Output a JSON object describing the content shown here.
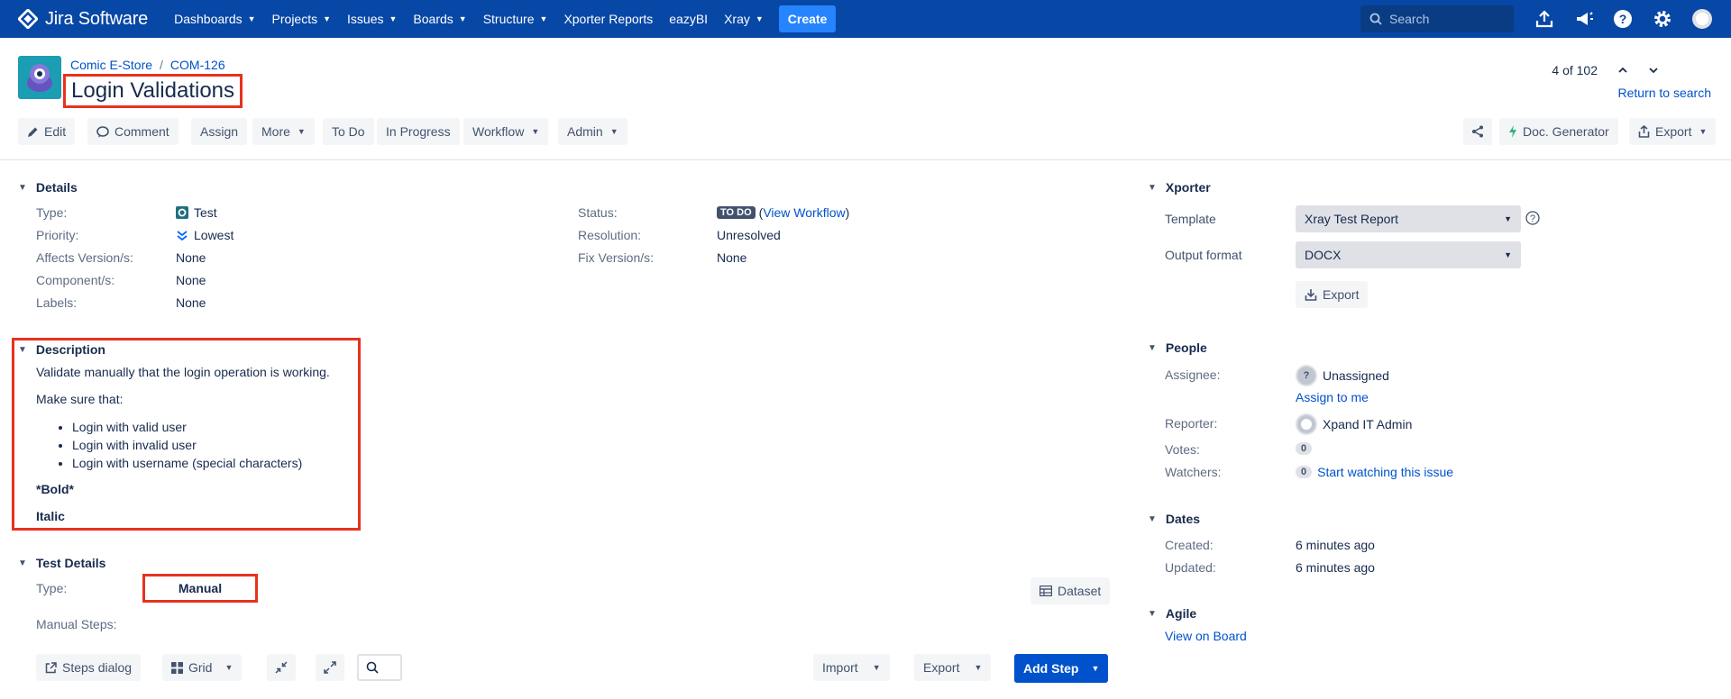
{
  "app": {
    "logo_text": "Jira Software",
    "nav": [
      {
        "label": "Dashboards",
        "dropdown": true
      },
      {
        "label": "Projects",
        "dropdown": true
      },
      {
        "label": "Issues",
        "dropdown": true
      },
      {
        "label": "Boards",
        "dropdown": true
      },
      {
        "label": "Structure",
        "dropdown": true
      },
      {
        "label": "Xporter Reports",
        "dropdown": false
      },
      {
        "label": "eazyBI",
        "dropdown": false
      },
      {
        "label": "Xray",
        "dropdown": true
      }
    ],
    "create_label": "Create",
    "search_placeholder": "Search"
  },
  "header": {
    "breadcrumb_project": "Comic E-Store",
    "breadcrumb_sep": "/",
    "breadcrumb_issue": "COM-126",
    "title": "Login Validations",
    "pager": "4 of 102",
    "return_link": "Return to search"
  },
  "toolbar": {
    "edit": "Edit",
    "comment": "Comment",
    "assign": "Assign",
    "more": "More",
    "todo": "To Do",
    "in_progress": "In Progress",
    "workflow": "Workflow",
    "admin": "Admin",
    "doc_generator": "Doc. Generator",
    "export": "Export"
  },
  "details": {
    "heading": "Details",
    "type_label": "Type:",
    "type_value": "Test",
    "priority_label": "Priority:",
    "priority_value": "Lowest",
    "affects_label": "Affects Version/s:",
    "affects_value": "None",
    "component_label": "Component/s:",
    "component_value": "None",
    "labels_label": "Labels:",
    "labels_value": "None",
    "status_label": "Status:",
    "status_value": "TO DO",
    "view_workflow": "View Workflow",
    "resolution_label": "Resolution:",
    "resolution_value": "Unresolved",
    "fix_label": "Fix Version/s:",
    "fix_value": "None"
  },
  "description": {
    "heading": "Description",
    "line1": "Validate manually that the login operation is working.",
    "line2": "Make sure that:",
    "items": [
      "Login with valid user",
      "Login with invalid user",
      "Login with username (special characters)"
    ],
    "bold": "*Bold*",
    "italic": "Italic"
  },
  "test_details": {
    "heading": "Test Details",
    "type_label": "Type:",
    "type_value": "Manual",
    "dataset": "Dataset",
    "manual_steps_label": "Manual Steps:",
    "steps_dialog": "Steps dialog",
    "grid": "Grid",
    "import": "Import",
    "export": "Export",
    "add_step": "Add Step"
  },
  "xporter": {
    "heading": "Xporter",
    "template_label": "Template",
    "template_value": "Xray Test Report",
    "output_label": "Output format",
    "output_value": "DOCX",
    "export": "Export"
  },
  "people": {
    "heading": "People",
    "assignee_label": "Assignee:",
    "assignee_value": "Unassigned",
    "assign_to_me": "Assign to me",
    "reporter_label": "Reporter:",
    "reporter_value": "Xpand IT Admin",
    "votes_label": "Votes:",
    "votes_value": "0",
    "watchers_label": "Watchers:",
    "watchers_value": "0",
    "start_watching": "Start watching this issue"
  },
  "dates": {
    "heading": "Dates",
    "created_label": "Created:",
    "created_value": "6 minutes ago",
    "updated_label": "Updated:",
    "updated_value": "6 minutes ago"
  },
  "agile": {
    "heading": "Agile",
    "view_on_board": "View on Board"
  },
  "colors": {
    "nav_bg": "#0747a6",
    "create_bg": "#2684ff",
    "highlight": "#e8321e",
    "link": "#0052cc"
  }
}
